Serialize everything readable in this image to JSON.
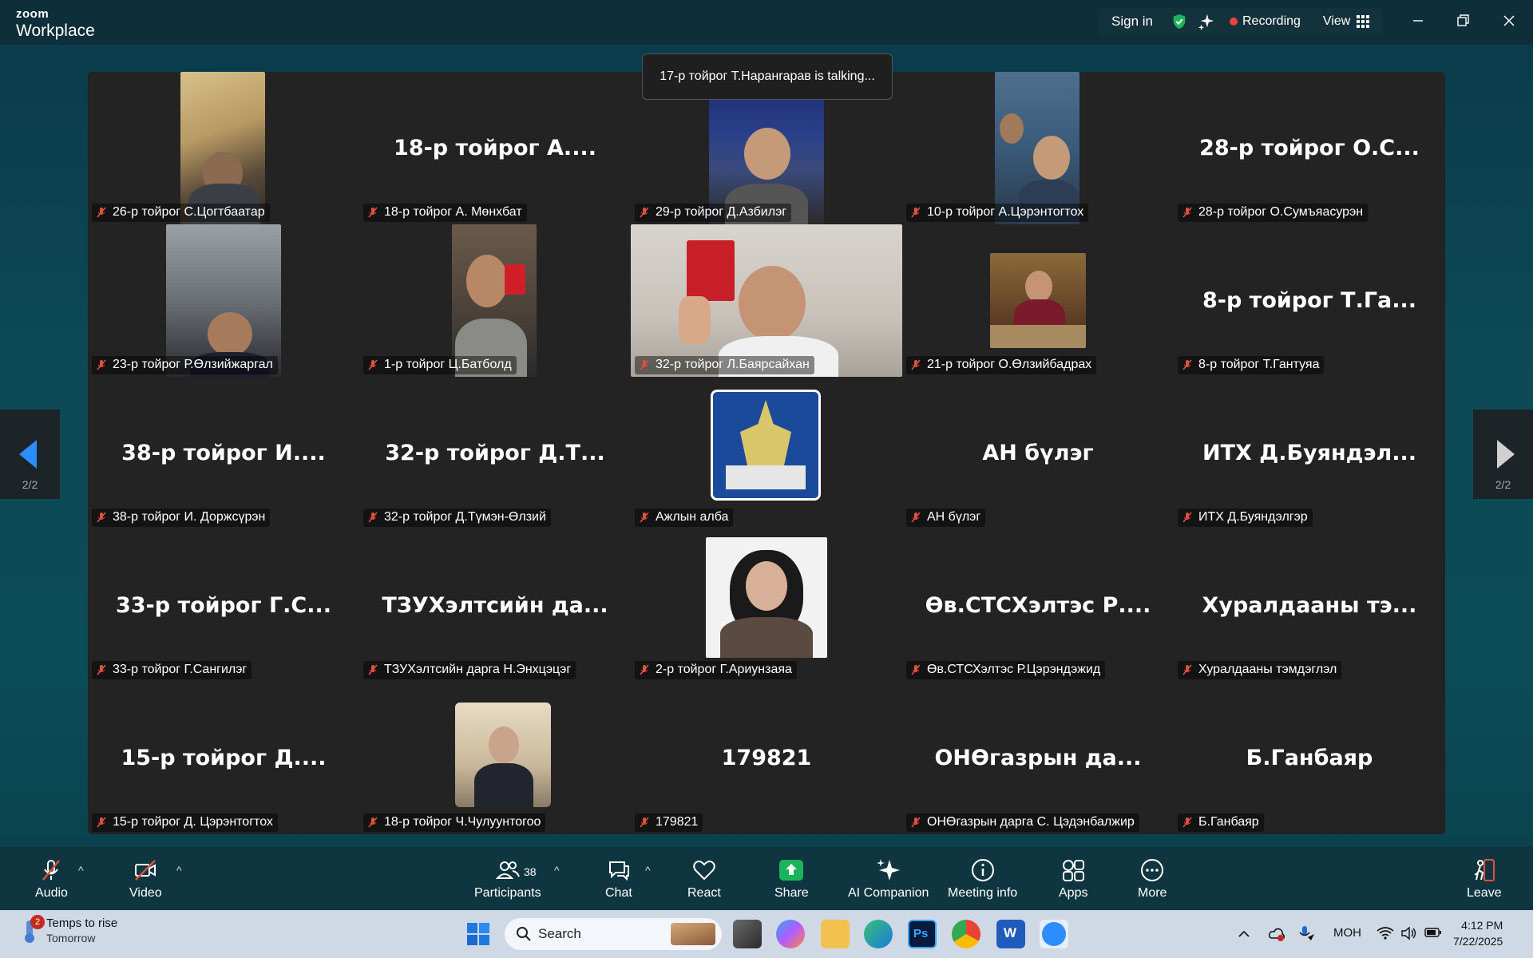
{
  "app": {
    "brand_top": "zoom",
    "brand_bottom": "Workplace"
  },
  "header": {
    "sign_in": "Sign in",
    "recording": "Recording",
    "view": "View"
  },
  "talking_banner": "17-р тойрог Т.Наранrарав is talking...",
  "page_indicator": "2/2",
  "tiles": [
    {
      "bigname": "",
      "label": "26-р тойрог С.Цогтбаатар",
      "video": true
    },
    {
      "bigname": "18-р тойрог А....",
      "label": "18-р тойрог А. Мөнхбат",
      "video": false
    },
    {
      "bigname": "",
      "label": "29-р тойрог Д.Азбилэг",
      "video": true
    },
    {
      "bigname": "",
      "label": "10-р тойрог А.Цэрэнтогтох",
      "video": true
    },
    {
      "bigname": "28-р тойрог О.С...",
      "label": "28-р тойрог О.Сумъяасурэн",
      "video": false
    },
    {
      "bigname": "",
      "label": "23-р тойрог Р.Өлзийжаргал",
      "video": true
    },
    {
      "bigname": "",
      "label": "1-р тойрог Ц.Батболд",
      "video": true
    },
    {
      "bigname": "",
      "label": "32-р тойрог Л.Баярсайхан",
      "video": true
    },
    {
      "bigname": "",
      "label": "21-р тойрог О.Өлзийбадрах",
      "video": true
    },
    {
      "bigname": "8-р тойрог Т.Га...",
      "label": "8-р тойрог Т.Гантуяа",
      "video": false
    },
    {
      "bigname": "38-р тойрог И....",
      "label": "38-р тойрог И. Доржсүрэн",
      "video": false
    },
    {
      "bigname": "32-р тойрог Д.Т...",
      "label": "32-р тойрог Д.Түмэн-Өлзий",
      "video": false
    },
    {
      "bigname": "",
      "label": "Ажлын алба",
      "video": true
    },
    {
      "bigname": "АН бүлэг",
      "label": "АН бүлэг",
      "video": false
    },
    {
      "bigname": "ИТХ Д.Буяндэл...",
      "label": "ИТХ Д.Буяндэлгэр",
      "video": false
    },
    {
      "bigname": "33-р тойрог Г.С...",
      "label": "33-р тойрог Г.Сангилэг",
      "video": false
    },
    {
      "bigname": "ТЗУХэлтсийн да...",
      "label": "ТЗУХэлтсийн дарга Н.Энхцэцэг",
      "video": false
    },
    {
      "bigname": "",
      "label": "2-р тойрог Г.Ариунзаяа",
      "video": true
    },
    {
      "bigname": "Өв.СТСХэлтэс Р....",
      "label": "Өв.СТСХэлтэс Р.Цэрэндэжид",
      "video": false
    },
    {
      "bigname": "Хуралдааны тэ...",
      "label": "Хуралдааны тэмдэглэл",
      "video": false
    },
    {
      "bigname": "15-р тойрог Д....",
      "label": "15-р тойрог Д. Цэрэнтогтох",
      "video": false
    },
    {
      "bigname": "",
      "label": "18-р тойрог Ч.Чулуунтогоо",
      "video": true
    },
    {
      "bigname": "179821",
      "label": "179821",
      "video": false
    },
    {
      "bigname": "ОНӨгазрын да...",
      "label": "ОНӨгазрын дарга С. Цэдэнбалжир",
      "video": false
    },
    {
      "bigname": "Б.Ганбаяр",
      "label": "Б.Ганбаяр",
      "video": false
    }
  ],
  "toolbar": {
    "audio": "Audio",
    "video": "Video",
    "participants": "Participants",
    "participants_count": "38",
    "chat": "Chat",
    "react": "React",
    "share": "Share",
    "ai_companion": "AI Companion",
    "meeting_info": "Meeting info",
    "apps": "Apps",
    "more": "More",
    "leave": "Leave"
  },
  "taskbar": {
    "weather_title": "Temps to rise",
    "weather_sub": "Tomorrow",
    "weather_badge": "2",
    "search": "Search",
    "language": "МОН",
    "time": "4:12 PM",
    "date": "7/22/2025"
  },
  "colors": {
    "accent_green": "#1bb35b",
    "accent_blue": "#2d8cff",
    "record_red": "#e8453c",
    "muted_mic": "#e0513b"
  }
}
